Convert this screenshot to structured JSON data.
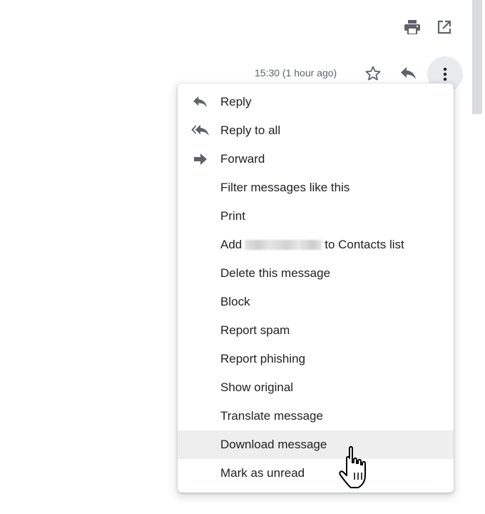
{
  "header": {
    "icons": {
      "print": "print-icon",
      "popout": "open-in-new-window-icon"
    }
  },
  "message": {
    "timestamp": "15:30 (1 hour ago)",
    "icons": {
      "star": "star-icon",
      "reply": "reply-icon",
      "more": "more-vertical-icon"
    }
  },
  "menu": {
    "items": [
      {
        "label": "Reply",
        "icon": "reply-icon"
      },
      {
        "label": "Reply to all",
        "icon": "reply-all-icon"
      },
      {
        "label": "Forward",
        "icon": "forward-icon"
      },
      {
        "label": "Filter messages like this"
      },
      {
        "label": "Print"
      },
      {
        "label_prefix": "Add",
        "label_suffix": "to Contacts list"
      },
      {
        "label": "Delete this message"
      },
      {
        "label": "Block"
      },
      {
        "label": "Report spam"
      },
      {
        "label": "Report phishing"
      },
      {
        "label": "Show original"
      },
      {
        "label": "Translate message"
      },
      {
        "label": "Download message",
        "hovered": true
      },
      {
        "label": "Mark as unread"
      }
    ]
  },
  "colors": {
    "icon_gray": "#5f6368",
    "hover_bg": "#eeeeee",
    "more_button_bg": "#e8eaed"
  }
}
